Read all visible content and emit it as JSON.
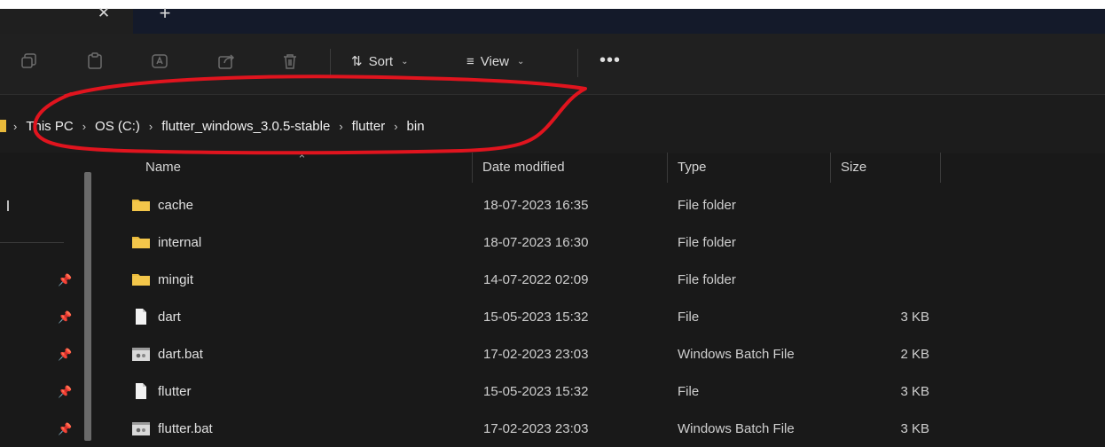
{
  "titlebar": {
    "close_tab_glyph": "✕",
    "new_tab_glyph": "+"
  },
  "toolbar": {
    "icons": [
      "new-item-icon",
      "copy-icon",
      "paste-icon",
      "rename-icon",
      "share-icon",
      "delete-icon"
    ],
    "sort_label": "Sort",
    "view_label": "View",
    "more_label": "•••"
  },
  "breadcrumb": {
    "items": [
      "This PC",
      "OS (C:)",
      "flutter_windows_3.0.5-stable",
      "flutter",
      "bin"
    ],
    "separator": "›"
  },
  "nav": {
    "pinned_count": 5
  },
  "columns": {
    "name": "Name",
    "date": "Date modified",
    "type": "Type",
    "size": "Size"
  },
  "files": [
    {
      "name": "cache",
      "date": "18-07-2023 16:35",
      "type": "File folder",
      "size": "",
      "icon": "folder-icon"
    },
    {
      "name": "internal",
      "date": "18-07-2023 16:30",
      "type": "File folder",
      "size": "",
      "icon": "folder-icon"
    },
    {
      "name": "mingit",
      "date": "14-07-2022 02:09",
      "type": "File folder",
      "size": "",
      "icon": "folder-icon"
    },
    {
      "name": "dart",
      "date": "15-05-2023 15:32",
      "type": "File",
      "size": "3 KB",
      "icon": "file-icon"
    },
    {
      "name": "dart.bat",
      "date": "17-02-2023 23:03",
      "type": "Windows Batch File",
      "size": "2 KB",
      "icon": "batch-file-icon"
    },
    {
      "name": "flutter",
      "date": "15-05-2023 15:32",
      "type": "File",
      "size": "3 KB",
      "icon": "file-icon"
    },
    {
      "name": "flutter.bat",
      "date": "17-02-2023 23:03",
      "type": "Windows Batch File",
      "size": "3 KB",
      "icon": "batch-file-icon"
    }
  ],
  "colors": {
    "folder": "#e8b93a",
    "annotation": "#e0141e",
    "background": "#191919"
  }
}
